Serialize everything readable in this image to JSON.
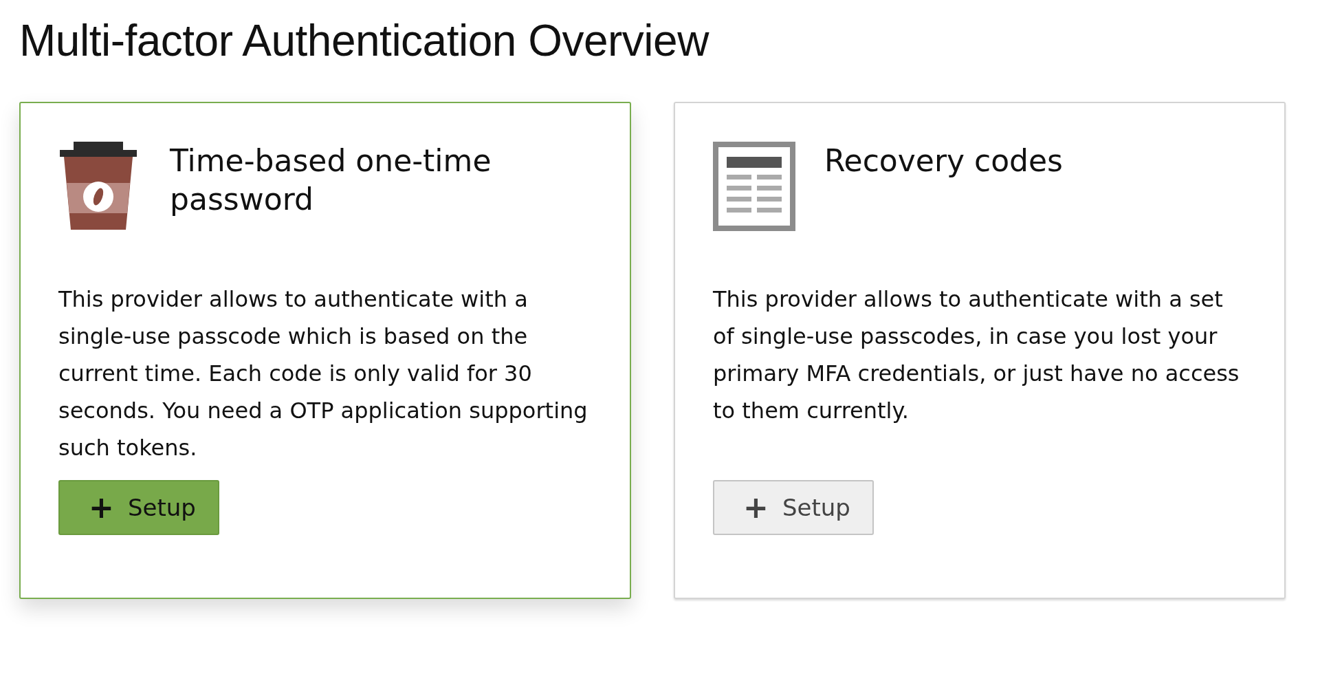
{
  "title": "Multi-factor Authentication Overview",
  "providers": [
    {
      "kind": "totp",
      "selected": true,
      "heading": "Time-based one-time password",
      "description": "This provider allows to authenticate with a single-use passcode which is based on the current time. Each code is only valid for 30 seconds. You need a OTP application supporting such tokens.",
      "button": {
        "icon": "+",
        "label": "Setup",
        "primary": true
      }
    },
    {
      "kind": "recovery",
      "selected": false,
      "heading": "Recovery codes",
      "description": "This provider allows to authenticate with a set of single-use passcodes, in case you lost your primary MFA credentials, or just have no access to them currently.",
      "button": {
        "icon": "+",
        "label": "Setup",
        "primary": false
      }
    }
  ]
}
